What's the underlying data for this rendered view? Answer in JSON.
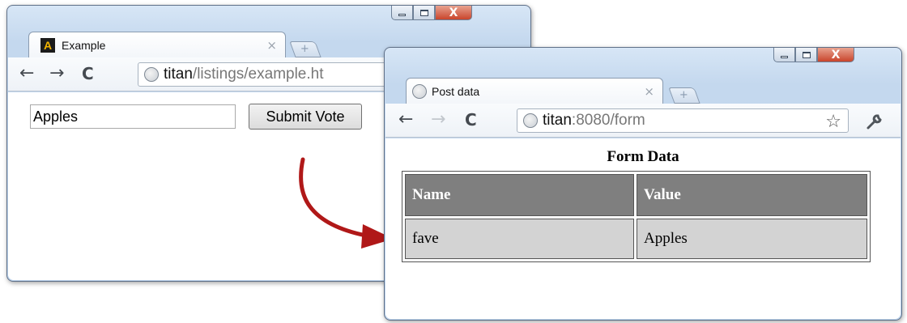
{
  "back_window": {
    "tab_title": "Example",
    "tab_close": "×",
    "url_host": "titan",
    "url_path": "/listings/example.ht",
    "input_value": "Apples",
    "submit_label": "Submit Vote",
    "favicon_letter": "A"
  },
  "front_window": {
    "tab_title": "Post data",
    "tab_close": "×",
    "url_host": "titan",
    "url_path": ":8080/form",
    "page": {
      "caption": "Form Data",
      "table": {
        "headers": [
          "Name",
          "Value"
        ],
        "rows": [
          [
            "fave",
            "Apples"
          ]
        ]
      }
    }
  },
  "icons": {
    "back": "←",
    "forward": "→",
    "reload": "C",
    "star": "☆",
    "wrench": "🔧",
    "new_tab": "+",
    "close_x": "X"
  },
  "colors": {
    "arrow": "#b01818",
    "header_bg": "#7f7f7f",
    "cell_bg": "#d3d3d3"
  }
}
